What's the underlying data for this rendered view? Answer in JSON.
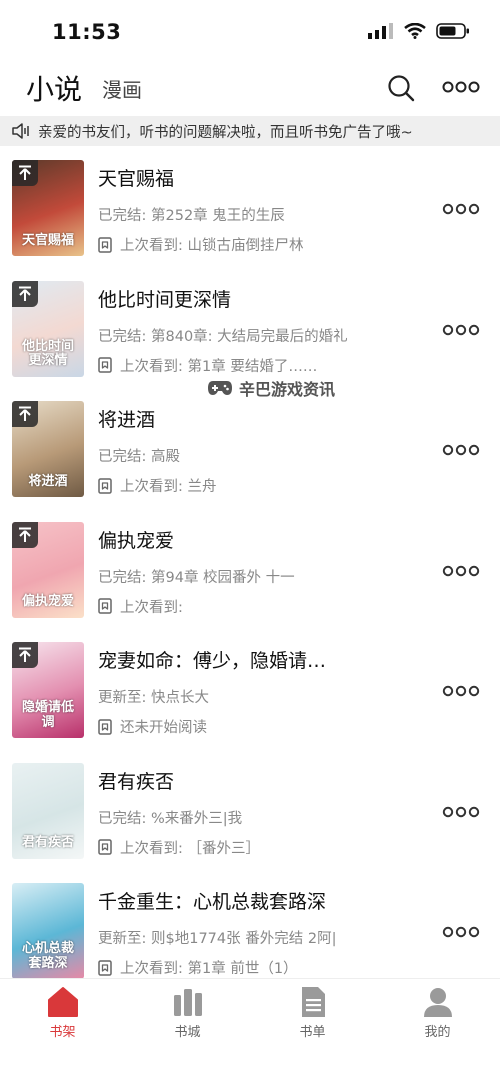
{
  "status_bar": {
    "time": "11:53"
  },
  "header": {
    "tab_novel": "小说",
    "tab_comic": "漫画"
  },
  "notice": {
    "text": "亲爱的书友们，听书的问题解决啦，而且听书免广告了哦~"
  },
  "books": [
    {
      "title": "天官赐福",
      "status": "已完结: 第252章 鬼王的生辰",
      "last_read": "上次看到: 山锁古庙倒挂尸林",
      "cover_caption": "天官赐福",
      "pinned": true,
      "cover_colors": [
        "#5a3a2a",
        "#c24a3a",
        "#e8c38a"
      ]
    },
    {
      "title": "他比时间更深情",
      "status": "已完结: 第840章: 大结局完最后的婚礼",
      "last_read": "上次看到: 第1章 要结婚了……",
      "cover_caption": "他比时间更深情",
      "pinned": true,
      "cover_colors": [
        "#dfeaf2",
        "#f3d9d2",
        "#c9d7e6"
      ]
    },
    {
      "title": "将进酒",
      "status": "已完结: 高殿",
      "last_read": "上次看到: 兰舟",
      "cover_caption": "将进酒",
      "pinned": true,
      "cover_colors": [
        "#e7dcc8",
        "#b89a78",
        "#6f5a44"
      ]
    },
    {
      "title": "偏执宠爱",
      "status": "已完结: 第94章 校园番外 十一",
      "last_read": "上次看到:",
      "cover_caption": "偏执宠爱",
      "pinned": true,
      "cover_colors": [
        "#f6c3c8",
        "#f0a6b0",
        "#fbe0c8"
      ]
    },
    {
      "title": "宠妻如命：傅少，隐婚请…",
      "status": "更新至: 快点长大",
      "last_read": "还未开始阅读",
      "cover_caption": "隐婚请低调",
      "pinned": true,
      "cover_colors": [
        "#f7e6ee",
        "#e38fb0",
        "#b8306a"
      ]
    },
    {
      "title": "君有疾否",
      "status": "已完结: %来番外三|我",
      "last_read": "上次看到: ［番外三］",
      "cover_caption": "君有疾否",
      "pinned": false,
      "cover_colors": [
        "#e9f1f2",
        "#d6e5e6",
        "#f4f7f7"
      ]
    },
    {
      "title": "千金重生：心机总裁套路深",
      "status": "更新至: 则$地1774张 番外完结 2阿|",
      "last_read": "上次看到: 第1章 前世（1）",
      "cover_caption": "心机总裁套路深",
      "pinned": false,
      "cover_colors": [
        "#d8eef5",
        "#5cb7d6",
        "#e889a6"
      ]
    }
  ],
  "watermark": {
    "text": "辛巴游戏资讯"
  },
  "tab_bar": {
    "items": [
      {
        "label": "书架",
        "active": true
      },
      {
        "label": "书城",
        "active": false
      },
      {
        "label": "书单",
        "active": false
      },
      {
        "label": "我的",
        "active": false
      }
    ]
  },
  "colors": {
    "accent": "#d9383a",
    "icon_gray": "#9a9a9a"
  }
}
